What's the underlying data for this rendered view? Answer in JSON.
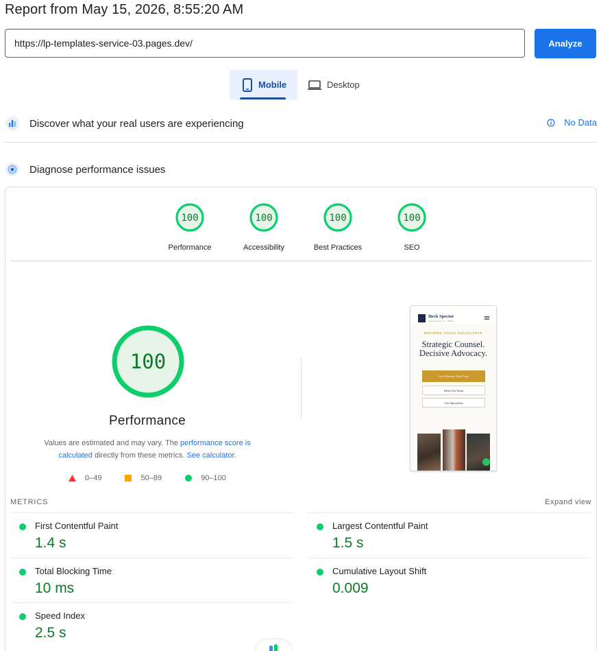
{
  "header": {
    "title": "Report from May 15, 2026, 8:55:20 AM"
  },
  "url_bar": {
    "value": "https://lp-templates-service-03.pages.dev/",
    "analyze_label": "Analyze"
  },
  "tabs": [
    {
      "label": "Mobile",
      "icon": "smartphone-icon",
      "selected": true
    },
    {
      "label": "Desktop",
      "icon": "laptop-icon",
      "selected": false
    }
  ],
  "crux": {
    "title": "Discover what your real users are experiencing",
    "status": "No Data"
  },
  "diagnose": {
    "title": "Diagnose performance issues"
  },
  "categories": [
    {
      "label": "Performance",
      "score": "100"
    },
    {
      "label": "Accessibility",
      "score": "100"
    },
    {
      "label": "Best Practices",
      "score": "100"
    },
    {
      "label": "SEO",
      "score": "100"
    }
  ],
  "performance": {
    "score": "100",
    "label": "Performance",
    "note_prefix": "Values are estimated and may vary. The ",
    "note_link1": "performance score is calculated",
    "note_middle": " directly from these metrics. ",
    "note_link2": "See calculator."
  },
  "legend": [
    {
      "range": "0–49",
      "color": "#ff3333"
    },
    {
      "range": "50–89",
      "color": "#ffa400"
    },
    {
      "range": "90–100",
      "color": "#0cce6b"
    }
  ],
  "screenshot": {
    "brand": "Heck Spector",
    "brand_sub": "Attorneys at Law · Jakarta",
    "kicker": "DEFINING LEGAL EXCELLENCE",
    "headline_1": "Strategic Counsel.",
    "headline_2": "Decisive Advocacy.",
    "btn_primary": "Let's Discuss Your Case",
    "btn_team": "Meet Our Team",
    "btn_specialists": "Our Specialists"
  },
  "metrics_section": {
    "label": "METRICS",
    "expand": "Expand view"
  },
  "metrics": {
    "fcp": {
      "name": "First Contentful Paint",
      "value": "1.4 s"
    },
    "lcp": {
      "name": "Largest Contentful Paint",
      "value": "1.5 s"
    },
    "tbt": {
      "name": "Total Blocking Time",
      "value": "10 ms"
    },
    "cls": {
      "name": "Cumulative Layout Shift",
      "value": "0.009"
    },
    "si": {
      "name": "Speed Index",
      "value": "2.5 s"
    }
  },
  "colors": {
    "accent": "#1a73e8",
    "pass": "#0cce6b",
    "pass_text": "#0d7a27",
    "gauge_fill": "#e6f4ea"
  }
}
